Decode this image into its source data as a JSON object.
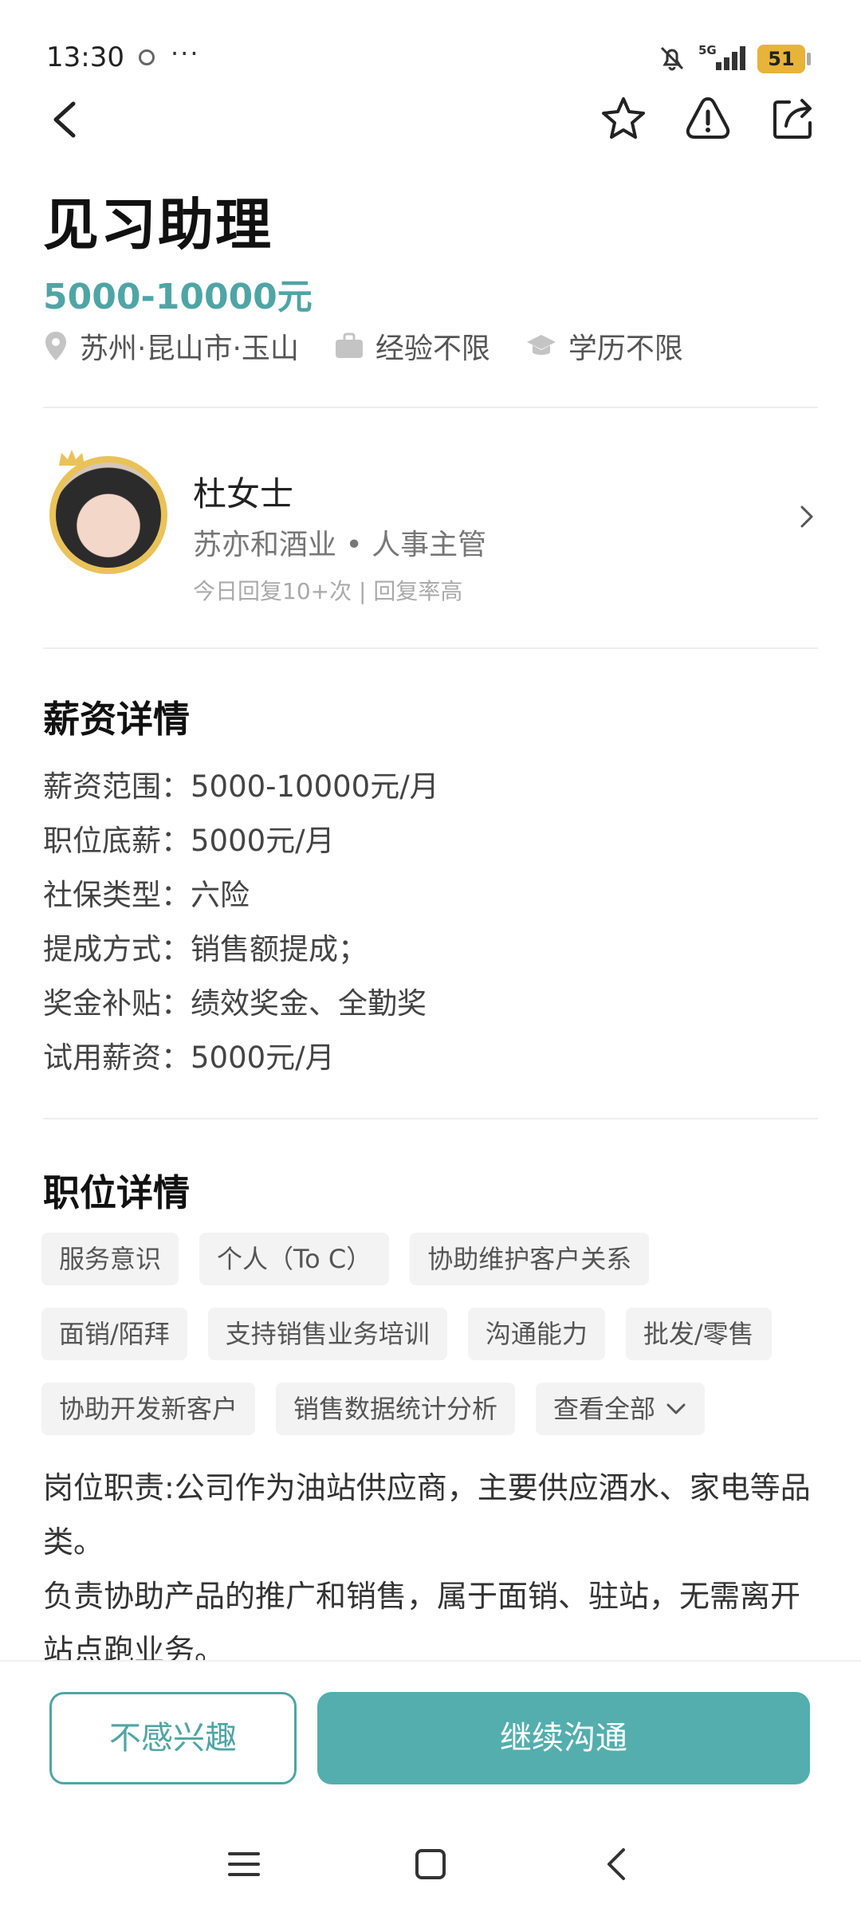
{
  "status_bar": {
    "time": "13:30",
    "more": "···",
    "signal": "5G",
    "battery": "51"
  },
  "nav": {
    "back": "back-icon",
    "favorite": "star-icon",
    "report": "warning-icon",
    "share": "share-icon"
  },
  "job": {
    "title": "见习助理",
    "salary": "5000-10000元",
    "location": "苏州·昆山市·玉山",
    "experience": "经验不限",
    "education": "学历不限"
  },
  "recruiter": {
    "name": "杜女士",
    "company_role": "苏亦和酒业 • 人事主管",
    "activity": "今日回复10+次 | 回复率高"
  },
  "salary_details": {
    "title": "薪资详情",
    "lines": [
      "薪资范围：5000-10000元/月",
      "职位底薪：5000元/月",
      "社保类型：六险",
      "提成方式：销售额提成；",
      "奖金补贴：绩效奖金、全勤奖",
      "试用薪资：5000元/月"
    ]
  },
  "job_details": {
    "title": "职位详情",
    "tags_row1": [
      "服务意识",
      "个人（To C）",
      "协助维护客户关系"
    ],
    "tags_row2": [
      "面销/陌拜",
      "支持销售业务培训",
      "沟通能力",
      "批发/零售"
    ],
    "tags_row3": [
      "协助开发新客户",
      "销售数据统计分析"
    ],
    "view_all": "查看全部",
    "description": [
      "岗位职责:公司作为油站供应商，主要供应酒水、家电等品类。",
      "负责协助产品的推广和销售，属于面销、驻站，无需离开站点跑业务。"
    ]
  },
  "actions": {
    "not_interested": "不感兴趣",
    "continue_chat": "继续沟通"
  },
  "colors": {
    "accent": "#54aeae",
    "battery": "#e8b339"
  }
}
